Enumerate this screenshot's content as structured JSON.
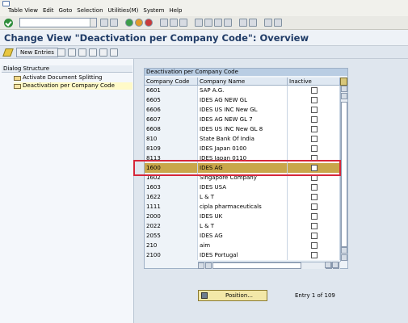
{
  "menubar": {
    "items": [
      "Table View",
      "Edit",
      "Goto",
      "Selection",
      "Utilities(M)",
      "System",
      "Help"
    ]
  },
  "page_title": "Change View \"Deactivation per Company Code\": Overview",
  "app_toolbar": {
    "new_entries": "New Entries"
  },
  "dialog_structure": {
    "header": "Dialog Structure",
    "items": [
      {
        "label": "Activate Document Splitting"
      },
      {
        "label": "Deactivation per Company Code"
      }
    ]
  },
  "table": {
    "title": "Deactivation per Company Code",
    "columns": [
      "Company Code",
      "Company Name",
      "Inactive"
    ],
    "rows": [
      {
        "code": "6601",
        "name": "SAP A.G."
      },
      {
        "code": "6605",
        "name": "IDES AG NEW GL"
      },
      {
        "code": "6606",
        "name": "IDES US INC New GL"
      },
      {
        "code": "6607",
        "name": "IDES AG NEW GL 7"
      },
      {
        "code": "6608",
        "name": "IDES US INC New GL 8"
      },
      {
        "code": "810",
        "name": "State Bank Of India"
      },
      {
        "code": "8109",
        "name": "IDES Japan 0100"
      },
      {
        "code": "8113",
        "name": "IDES Japan 0110"
      },
      {
        "code": "1600",
        "name": "IDES AG"
      },
      {
        "code": "1602",
        "name": "Singapore Company"
      },
      {
        "code": "1603",
        "name": "IDES USA"
      },
      {
        "code": "1622",
        "name": "L & T"
      },
      {
        "code": "1111",
        "name": "cipla pharmaceuticals"
      },
      {
        "code": "2000",
        "name": "IDES UK"
      },
      {
        "code": "2022",
        "name": "L & T"
      },
      {
        "code": "2055",
        "name": "IDES AG"
      },
      {
        "code": "210",
        "name": "aim"
      },
      {
        "code": "2100",
        "name": "IDES Portugal"
      }
    ],
    "selected_row_index": 8
  },
  "position_button": "Position...",
  "entry_info": "Entry 1 of 109",
  "colors": {
    "title_text": "#1f3b66",
    "selected_row": "#c9a64a",
    "highlight_box": "#d6273a",
    "table_header": "#b9cde3"
  }
}
